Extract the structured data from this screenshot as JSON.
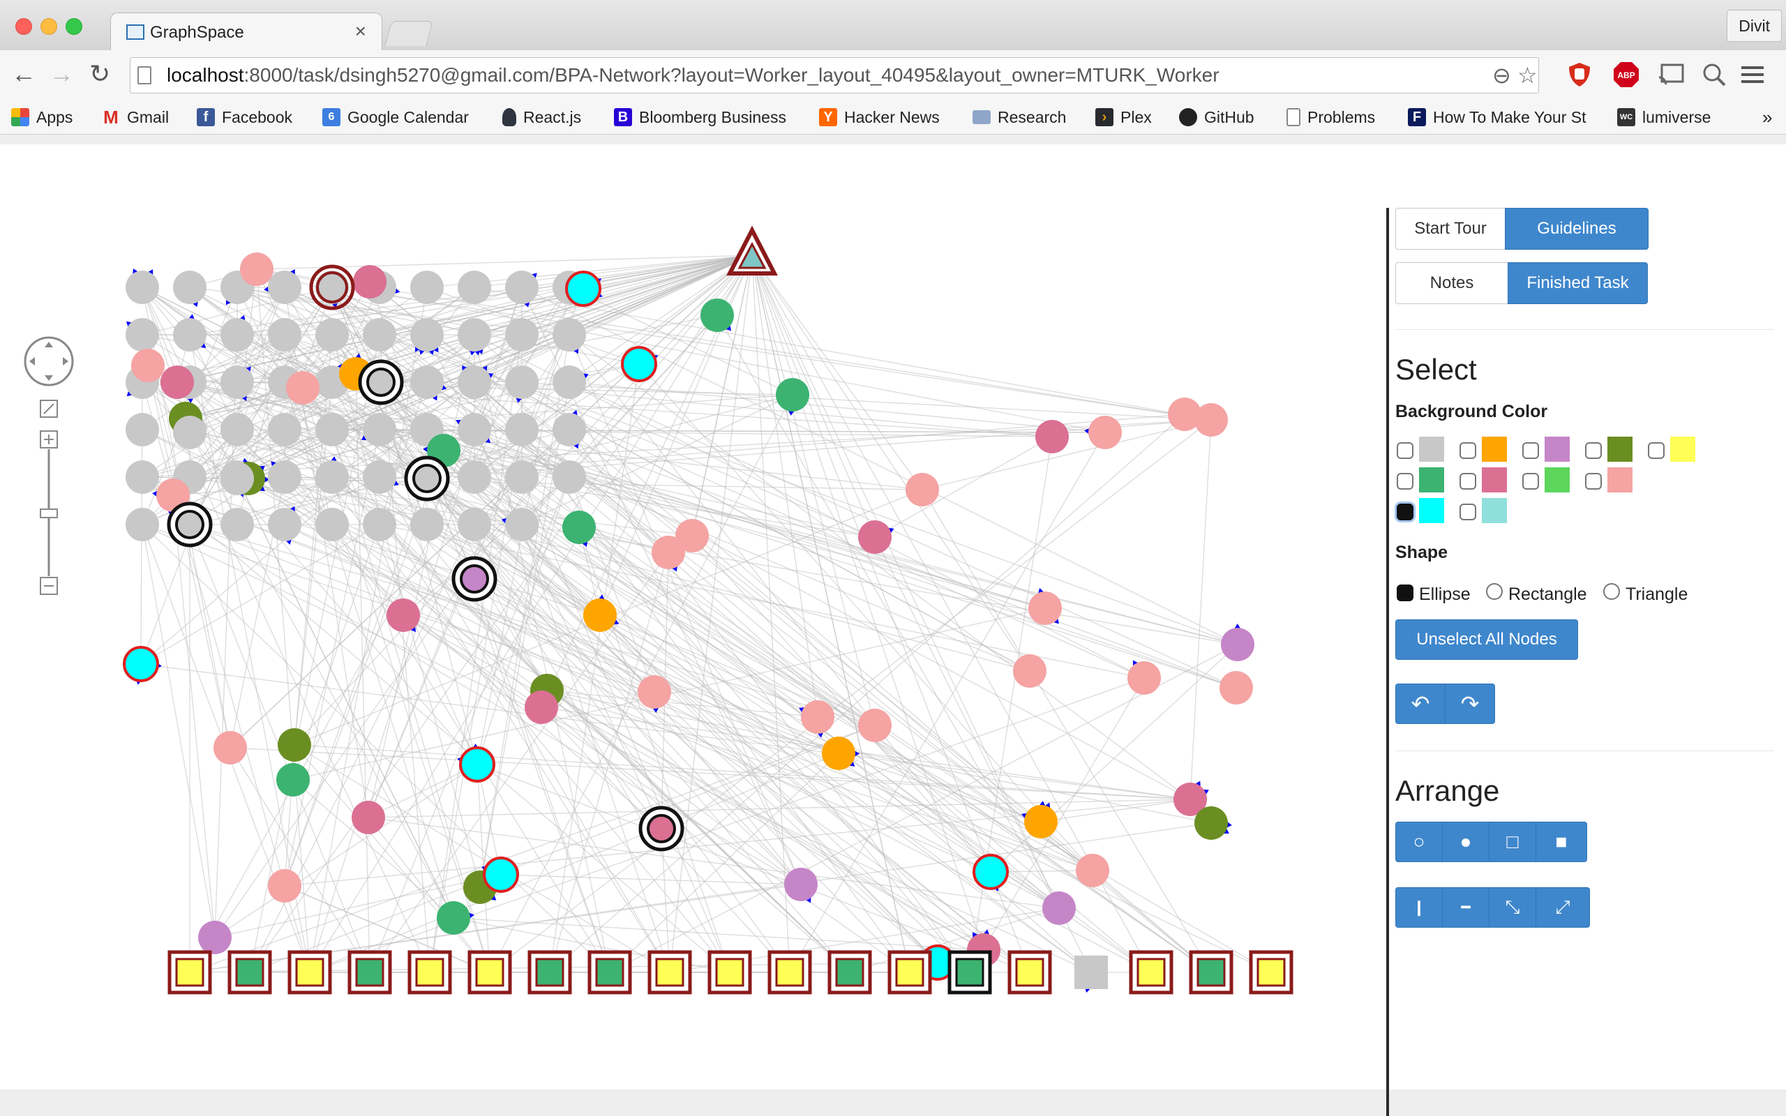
{
  "browser": {
    "tab_title": "GraphSpace",
    "tab_close": "×",
    "profile_name": "Divit",
    "url_host": "localhost",
    "url_rest": ":8000/task/dsingh5270@gmail.com/BPA-Network?layout=Worker_layout_40495&layout_owner=MTURK_Worker",
    "ext_abp": "ABP",
    "bookmarks_more": "»",
    "bookmarks": [
      {
        "label": "Apps",
        "icon": "apps-grid-icon",
        "color": "#e8453c"
      },
      {
        "label": "Gmail",
        "icon": "gmail-icon",
        "color": "#d93025"
      },
      {
        "label": "Facebook",
        "icon": "facebook-icon",
        "color": "#3b5998"
      },
      {
        "label": "Google Calendar",
        "icon": "calendar-icon",
        "color": "#3d7ee0"
      },
      {
        "label": "React.js",
        "icon": "react-icon",
        "color": "#2e3440"
      },
      {
        "label": "Bloomberg Business",
        "icon": "bloomberg-icon",
        "color": "#2800d7"
      },
      {
        "label": "Hacker News",
        "icon": "hacker-news-icon",
        "color": "#ff6600"
      },
      {
        "label": "Research",
        "icon": "folder-icon",
        "color": "#8fa6c8"
      },
      {
        "label": "Plex",
        "icon": "plex-icon",
        "color": "#282a2d"
      },
      {
        "label": "GitHub",
        "icon": "github-icon",
        "color": "#222222"
      },
      {
        "label": "Problems",
        "icon": "page-icon",
        "color": "#ffffff"
      },
      {
        "label": "How To Make Your St",
        "icon": "f-icon",
        "color": "#0b1a5c"
      },
      {
        "label": "lumiverse",
        "icon": "wc-icon",
        "color": "#333333"
      }
    ]
  },
  "panel": {
    "start_tour": "Start Tour",
    "guidelines": "Guidelines",
    "notes": "Notes",
    "finished_task": "Finished Task",
    "select_heading": "Select",
    "background_color_label": "Background Color",
    "color_swatches": [
      {
        "color": "#c8c8c8",
        "checked": false
      },
      {
        "color": "#ffa500",
        "checked": false
      },
      {
        "color": "#c586c8",
        "checked": false
      },
      {
        "color": "#6b8e23",
        "checked": false
      },
      {
        "color": "#ffff55",
        "checked": false
      },
      {
        "color": "#3cb371",
        "checked": false
      },
      {
        "color": "#db7093",
        "checked": false
      },
      {
        "color": "#5cd65c",
        "checked": false
      },
      {
        "color": "#f5a3a3",
        "checked": false
      },
      {
        "color": "#00ffff",
        "checked": true
      },
      {
        "color": "#8fe0dc",
        "checked": false
      }
    ],
    "shape_label": "Shape",
    "shapes": [
      {
        "label": "Ellipse",
        "checked": true
      },
      {
        "label": "Rectangle",
        "checked": false
      },
      {
        "label": "Triangle",
        "checked": false
      }
    ],
    "unselect_all": "Unselect All Nodes",
    "undo_icon": "↶",
    "redo_icon": "↷",
    "arrange_heading": "Arrange",
    "arrange_icons": [
      "○",
      "●",
      "□",
      "■"
    ],
    "align_icons": [
      "❙",
      "━",
      "⤡",
      "⤢"
    ]
  },
  "graph": {
    "colors": {
      "grey": "#c8c8c8",
      "pink": "#f5a3a3",
      "rose": "#db7093",
      "green": "#3cb371",
      "olive": "#6b8e23",
      "orange": "#ffa500",
      "purple": "#c586c8",
      "cyan": "#00ffff",
      "yellow": "#ffff55",
      "lime": "#3cb371",
      "darkred": "#8b1a1a",
      "edge": "#bdbdbd",
      "arrow": "#0000ff"
    }
  }
}
